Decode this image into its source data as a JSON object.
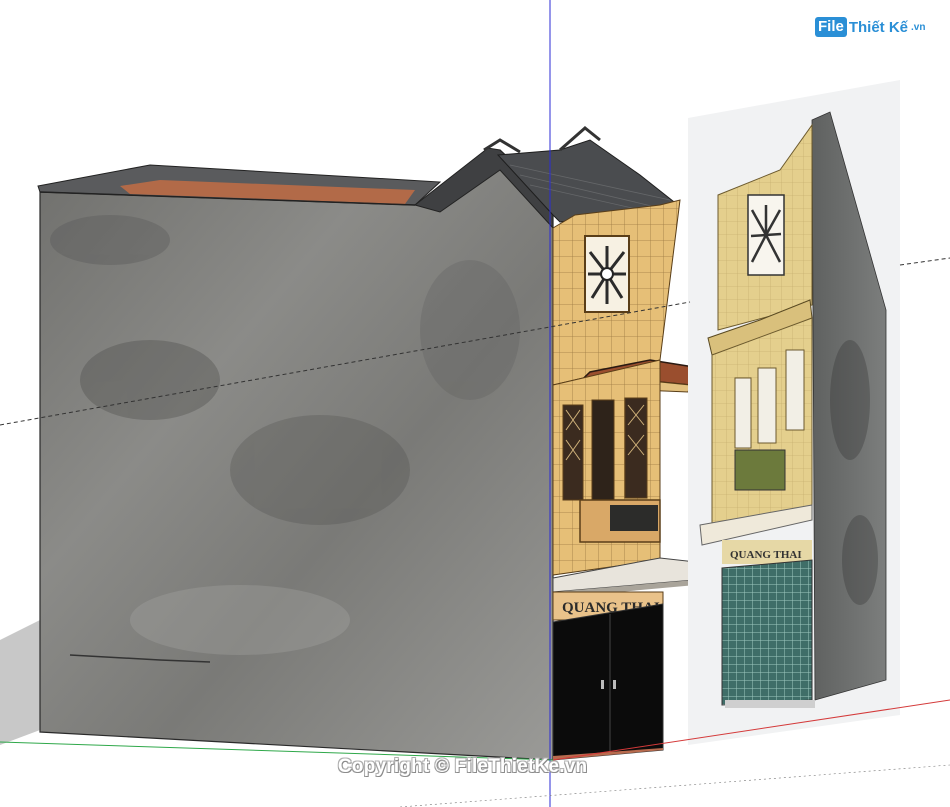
{
  "logo": {
    "badge": "File",
    "text": "Thiết Kế",
    "suffix": ".vn"
  },
  "watermark": "Copyright © FileThietKe.vn",
  "signage": {
    "model_sign": "QUANG THAI",
    "photo_sign": "QUANG THAI"
  },
  "colors": {
    "blue_axis": "#2b2bd6",
    "red_axis": "#d43a3a",
    "green_axis": "#2fa84a",
    "wall_gray": "#7d7d7b",
    "facade_yellow": "#e7c27a",
    "roof_dark": "#4a4c4f"
  }
}
